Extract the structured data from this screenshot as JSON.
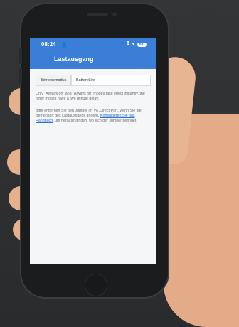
{
  "status": {
    "time": "08:24",
    "person_icon": "person-icon",
    "icons_text": "‡ ≋ ",
    "battery": "80"
  },
  "header": {
    "back_icon": "arrow-left-icon",
    "title": "Lastausgang"
  },
  "form": {
    "mode_label": "Betriebsmodus",
    "mode_value": "BatteryLife"
  },
  "notes": {
    "delay_note": "Only \"Always on\" and \"Always off\" modes take effect instantly, the other modes have a two minute delay.",
    "jumper_prefix": "Bitte entfernen Sie den Jumper im VE.Direct-Port, wenn Sie die Betriebsart des Lastausgangs ändern. ",
    "manual_link": "Konsultieren Sie das Handbuch",
    "jumper_suffix": ", um herauszufinden, wo sich der Jumper befindet."
  },
  "colors": {
    "app_bar": "#3b7ed7",
    "link": "#2f73d8"
  }
}
